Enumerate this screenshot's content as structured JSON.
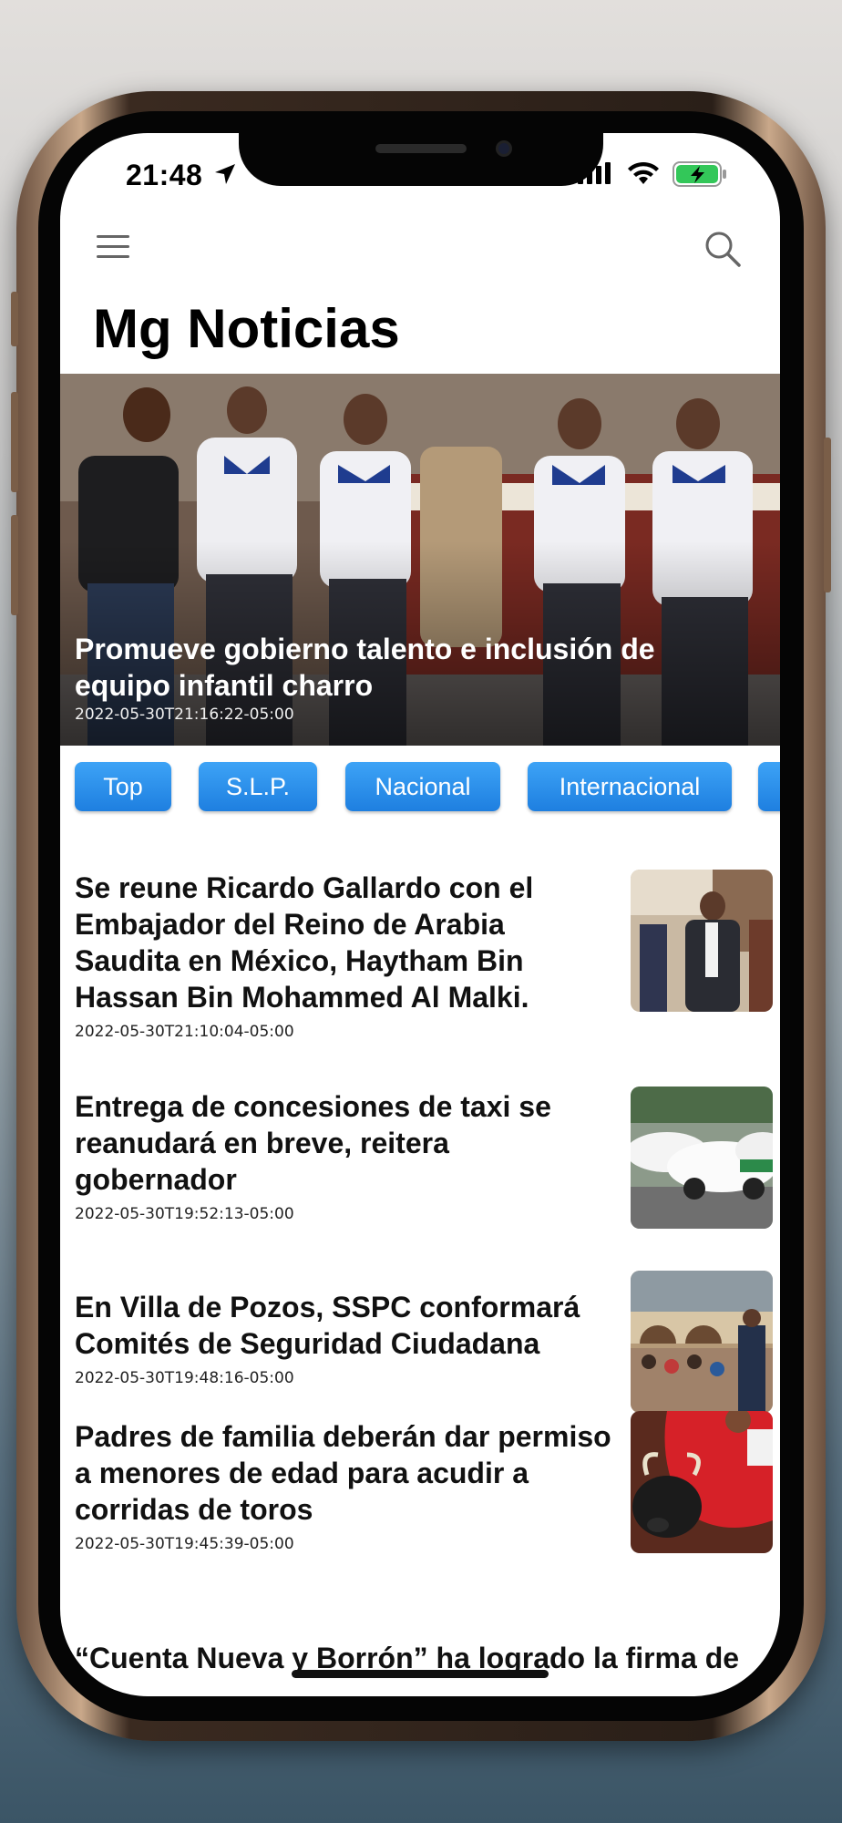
{
  "status_bar": {
    "time": "21:48"
  },
  "header": {
    "app_title": "Mg Noticias",
    "menu_icon": "hamburger-menu-icon",
    "search_icon": "search-icon"
  },
  "hero": {
    "title": "Promueve gobierno talento e inclusión de equipo infantil charro",
    "date": "2022-05-30T21:16:22-05:00"
  },
  "categories": [
    "Top",
    "S.L.P.",
    "Nacional",
    "Internacional"
  ],
  "articles": [
    {
      "title": "Se reune Ricardo Gallardo con el Embajador del Reino de Arabia Saudita en México, Haytham Bin Hassan Bin Mohammed Al Malki.",
      "date": "2022-05-30T21:10:04-05:00"
    },
    {
      "title": "Entrega de concesiones de taxi se reanudará en breve, reitera gobernador",
      "date": "2022-05-30T19:52:13-05:00"
    },
    {
      "title": "En Villa de Pozos, SSPC conformará Comités de Seguridad Ciudadana",
      "date": "2022-05-30T19:48:16-05:00"
    },
    {
      "title": "Padres de familia deberán dar permiso a menores de edad para acudir a corridas de toros",
      "date": "2022-05-30T19:45:39-05:00"
    }
  ],
  "partial_article": {
    "title": "“Cuenta Nueva y Borrón” ha logrado la firma de"
  },
  "colors": {
    "accent_blue": "#1e7fe0",
    "battery_green": "#33c759"
  }
}
